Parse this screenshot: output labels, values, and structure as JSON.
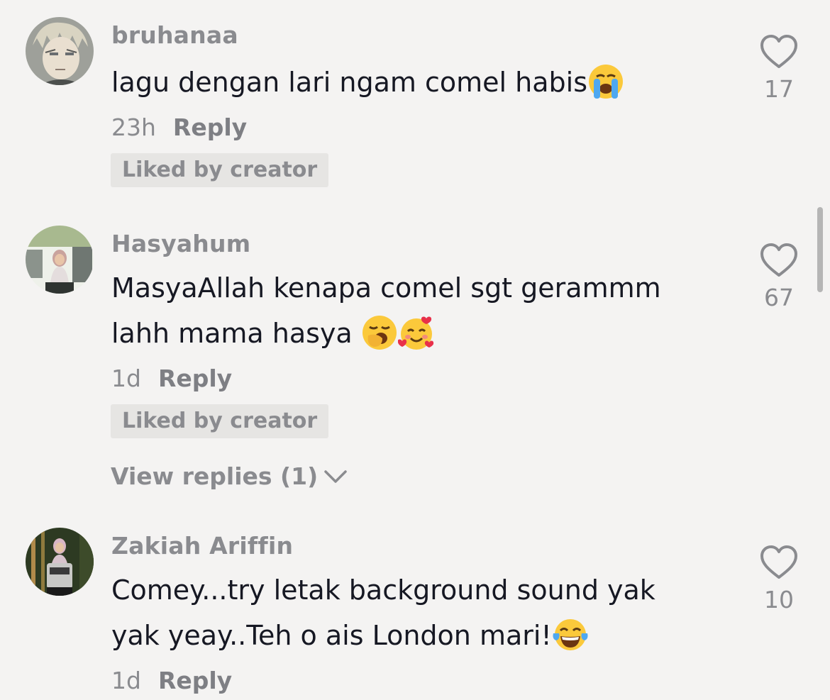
{
  "comments": [
    {
      "username": "bruhanaa",
      "text": "lagu dengan lari ngam comel habis",
      "emojis": [
        "loudly-crying-face"
      ],
      "time": "23h",
      "reply_label": "Reply",
      "badge": "Liked by creator",
      "likes": "17"
    },
    {
      "username": "Hasyahum",
      "text_line1": "MasyaAllah kenapa comel sgt gerammm",
      "text_line2": "lahh mama hasya ",
      "emojis": [
        "yawning-face",
        "smiling-face-with-hearts"
      ],
      "time": "1d",
      "reply_label": "Reply",
      "badge": "Liked by creator",
      "view_replies": "View replies (1)",
      "likes": "67"
    },
    {
      "username": "Zakiah Ariffin",
      "text_line1": "Comey...try letak background sound yak",
      "text_line2": "yak yeay..Teh o ais London mari!",
      "emojis": [
        "face-with-tears-of-joy"
      ],
      "time": "1d",
      "reply_label": "Reply",
      "likes": "10"
    }
  ],
  "colors": {
    "background": "#f4f3f2",
    "primary_text": "#161823",
    "secondary_text": "#8a8b8f",
    "badge_background": "#e6e5e3"
  }
}
